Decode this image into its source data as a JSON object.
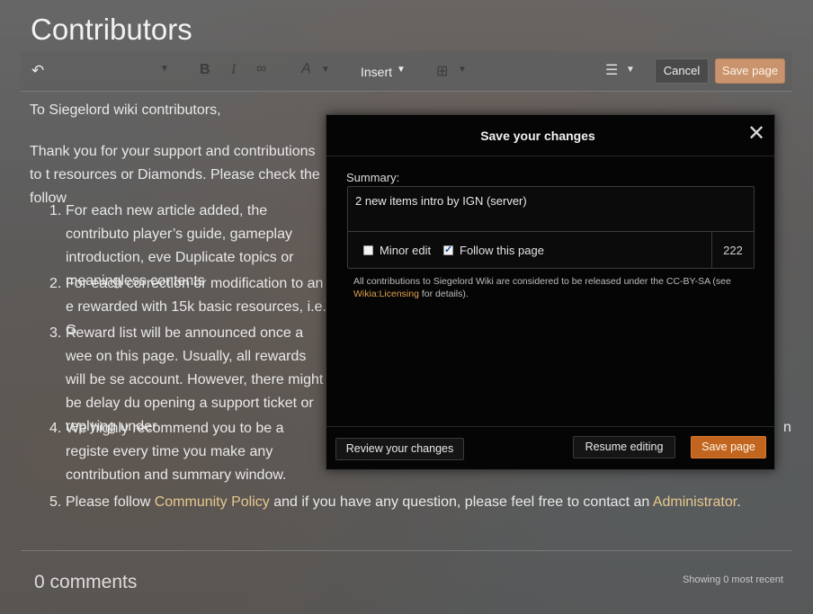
{
  "page": {
    "title": "Contributors"
  },
  "toolbar": {
    "undo_icon": "undo-icon",
    "insert_label": "Insert",
    "cancel_label": "Cancel",
    "save_label": "Save page"
  },
  "content": {
    "greeting": "To Siegelord wiki contributors,",
    "intro": "Thank you for your support and contributions to t resources or Diamonds. Please check the follow",
    "items": [
      {
        "num": "1.",
        "text": "For each new article added, the contributo player’s guide, gameplay introduction, eve Duplicate topics or meaningless contents"
      },
      {
        "num": "2.",
        "text": "For each correction or modification to an e rewarded with 15k basic resources, i.e. G"
      },
      {
        "num": "3.",
        "text": "Reward list will be announced once a wee on this page. Usually, all rewards will be se account. However, there might be delay du opening a support ticket or replying under"
      },
      {
        "num": "4.",
        "text": " We highly recommend you to be a registe every time you make any contribution and summary window.",
        "right_fragment": "n"
      },
      {
        "num": "5.",
        "text_before": "Please follow ",
        "link1": "Community Policy",
        "text_middle": " and if you have any question, please feel free to contact an ",
        "link2": "Administrator",
        "text_after": "."
      }
    ]
  },
  "comments": {
    "count_label": "0 comments",
    "showing_label": "Showing 0 most recent"
  },
  "modal": {
    "title": "Save your changes",
    "close_icon": "close-icon",
    "summary_label": "Summary:",
    "summary_value": "2 new items intro by IGN (server)",
    "minor_edit_label": "Minor edit",
    "minor_edit_checked": false,
    "follow_label": "Follow this page",
    "follow_checked": true,
    "char_count": "222",
    "license_text": "All contributions to Siegelord Wiki are considered to be released under the CC-BY-SA (see ",
    "license_link": "Wikia:Licensing",
    "license_after": " for details).",
    "review_label": "Review your changes",
    "resume_label": "Resume editing",
    "save_label": "Save page"
  },
  "colors": {
    "accent_orange": "#c2661f",
    "link_gold": "#e8c88e"
  }
}
